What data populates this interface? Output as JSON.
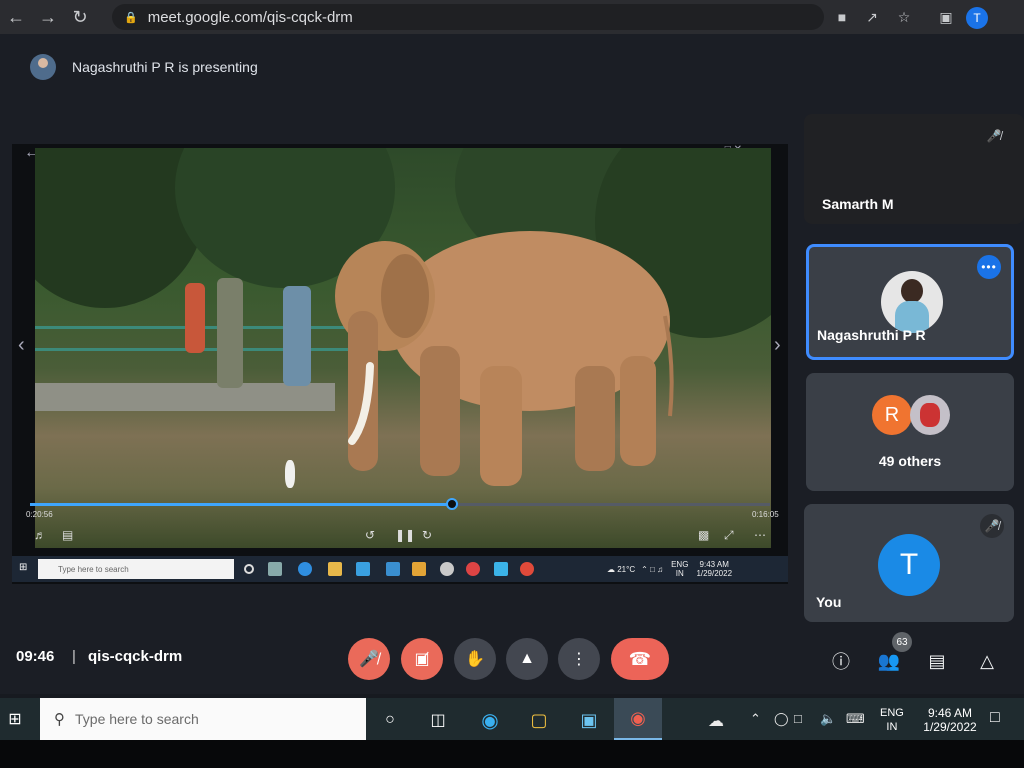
{
  "browser": {
    "url": "meet.google.com/qis-cqck-drm",
    "profile_initial": "T"
  },
  "meet": {
    "presenting_text": "Nagashruthi P R is presenting",
    "meeting_time": "09:46",
    "separator": "|",
    "meeting_code": "qis-cqck-drm",
    "people_count": "63"
  },
  "participants": {
    "samarth": {
      "name": "Samarth M"
    },
    "nagashruthi": {
      "name": "Nagashruthi P R"
    },
    "others": {
      "initial": "R",
      "label": "49 others"
    },
    "you": {
      "initial": "T",
      "name": "You"
    }
  },
  "video": {
    "time_current": "0:20:56",
    "time_total": "0:16:05",
    "progress": 0.57
  },
  "inner_taskbar": {
    "search_placeholder": "Type here to search",
    "temperature": "21°C",
    "lang_top": "ENG",
    "lang_bottom": "IN",
    "time": "9:43 AM",
    "date": "1/29/2022"
  },
  "taskbar": {
    "search_placeholder": "Type here to search",
    "lang_top": "ENG",
    "lang_bottom": "IN",
    "time": "9:46 AM",
    "date": "1/29/2022"
  },
  "colors": {
    "accent": "#1a73e8",
    "end_call": "#ec6458",
    "mic_off": "#ea6a5a"
  }
}
